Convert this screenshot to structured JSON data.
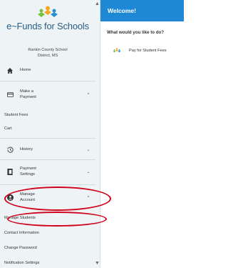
{
  "brand": {
    "logo_text": "e~Funds for Schools"
  },
  "sidebar": {
    "school_line1": "Rankin County School",
    "school_line2": "District, MS",
    "home": "Home",
    "make_payment_line1": "Make a",
    "make_payment_line2": "Payment",
    "student_fees": "Student Fees",
    "cart": "Cart",
    "history": "History",
    "payment_settings_line1": "Payment",
    "payment_settings_line2": "Settings",
    "manage_account_line1": "Manage",
    "manage_account_line2": "Account",
    "manage_students": "Manage Students",
    "contact_information": "Contact Information",
    "change_password": "Change Password",
    "notification_settings": "Notification Settings"
  },
  "main": {
    "title": "Welcome!",
    "prompt": "What would you like to do?",
    "action_label": "Pay for Student Fees"
  },
  "colors": {
    "header": "#1f88d4",
    "highlight": "#d0021b",
    "sidebar_bg": "#eef4f6"
  }
}
